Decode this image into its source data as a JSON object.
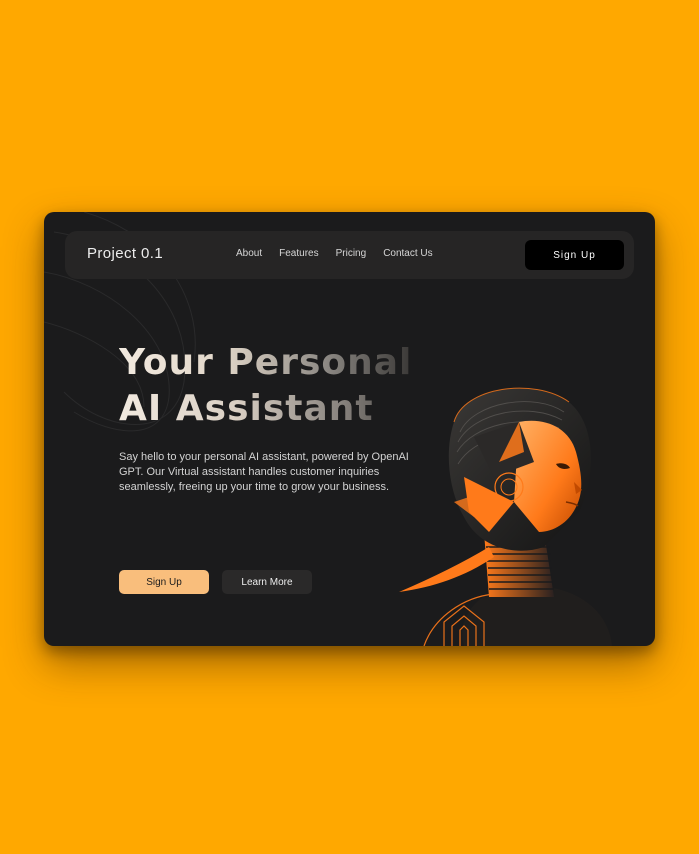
{
  "nav": {
    "brand": "Project 0.1",
    "links": [
      "About",
      "Features",
      "Pricing",
      "Contact Us"
    ],
    "signup_label": "Sign Up"
  },
  "hero": {
    "title_line1": "Your Personal",
    "title_line2": "AI Assistant",
    "description": "Say hello to your personal AI assistant, powered by OpenAI GPT. Our Virtual assistant handles customer inquiries seamlessly, freeing up your time to grow your business.",
    "primary_button": "Sign Up",
    "secondary_button": "Learn More"
  },
  "colors": {
    "background": "#FFA800",
    "card": "#1B1B1C",
    "navbar": "#262525",
    "accent": "#F9BE7C",
    "robot_orange": "#FF7A1A"
  }
}
